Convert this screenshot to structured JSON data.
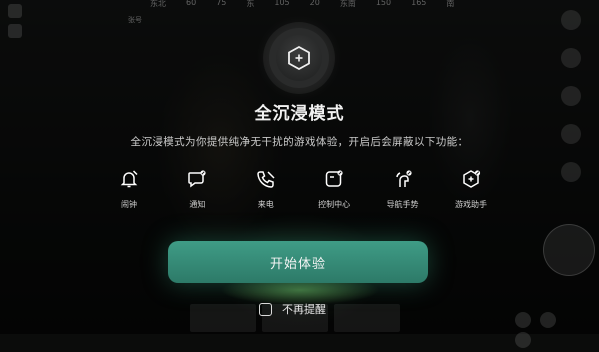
{
  "hud": {
    "compass": [
      "东北",
      "60",
      "75",
      "东",
      "105",
      "20",
      "东南",
      "150",
      "165",
      "南"
    ],
    "player_label": "张号"
  },
  "modal": {
    "logo_icon": "game-mode-icon",
    "title": "全沉浸模式",
    "description": "全沉浸模式为你提供纯净无干扰的游戏体验，开启后会屏蔽以下功能：",
    "features": [
      {
        "label": "闹钟",
        "icon": "alarm-off-icon"
      },
      {
        "label": "通知",
        "icon": "notification-off-icon"
      },
      {
        "label": "来电",
        "icon": "call-off-icon"
      },
      {
        "label": "控制中心",
        "icon": "control-center-off-icon"
      },
      {
        "label": "导航手势",
        "icon": "gesture-off-icon"
      },
      {
        "label": "游戏助手",
        "icon": "game-assistant-off-icon"
      }
    ],
    "start_button": "开始体验",
    "no_remind": "不再提醒",
    "no_remind_checked": false
  },
  "colors": {
    "accent": "#2d7a68",
    "overlay": "#000000"
  }
}
